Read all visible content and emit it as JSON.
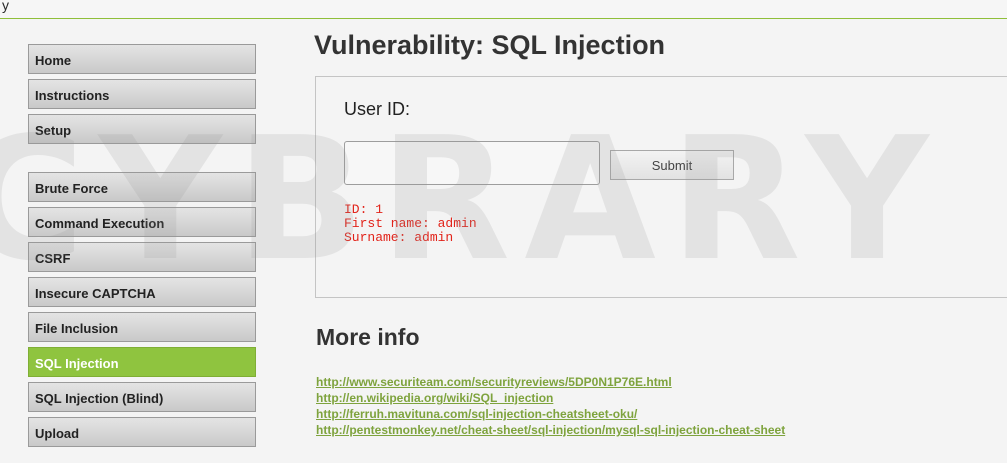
{
  "top_strip_text": "y",
  "watermark": "CYBRARY",
  "menu": {
    "items": [
      {
        "label": "Home",
        "active": false
      },
      {
        "label": "Instructions",
        "active": false
      },
      {
        "label": "Setup",
        "active": false
      },
      {
        "label": "Brute Force",
        "active": false
      },
      {
        "label": "Command Execution",
        "active": false
      },
      {
        "label": "CSRF",
        "active": false
      },
      {
        "label": "Insecure CAPTCHA",
        "active": false
      },
      {
        "label": "File Inclusion",
        "active": false
      },
      {
        "label": "SQL Injection",
        "active": true
      },
      {
        "label": "SQL Injection (Blind)",
        "active": false
      },
      {
        "label": "Upload",
        "active": false
      }
    ]
  },
  "main": {
    "title": "Vulnerability: SQL Injection",
    "form": {
      "user_id_label": "User ID:",
      "input_value": "",
      "submit_label": "Submit"
    },
    "result": {
      "id_line": "ID: 1",
      "first_name_line": "First name: admin",
      "surname_line": "Surname: admin"
    },
    "more_info": {
      "heading": "More info",
      "links": [
        "http://www.securiteam.com/securityreviews/5DP0N1P76E.html",
        "http://en.wikipedia.org/wiki/SQL_injection",
        "http://ferruh.mavituna.com/sql-injection-cheatsheet-oku/",
        "http://pentestmonkey.net/cheat-sheet/sql-injection/mysql-sql-injection-cheat-sheet"
      ]
    }
  },
  "colors": {
    "accent_green": "#8fc43f",
    "link_green": "#7ea33d",
    "result_red": "#e2231a"
  }
}
